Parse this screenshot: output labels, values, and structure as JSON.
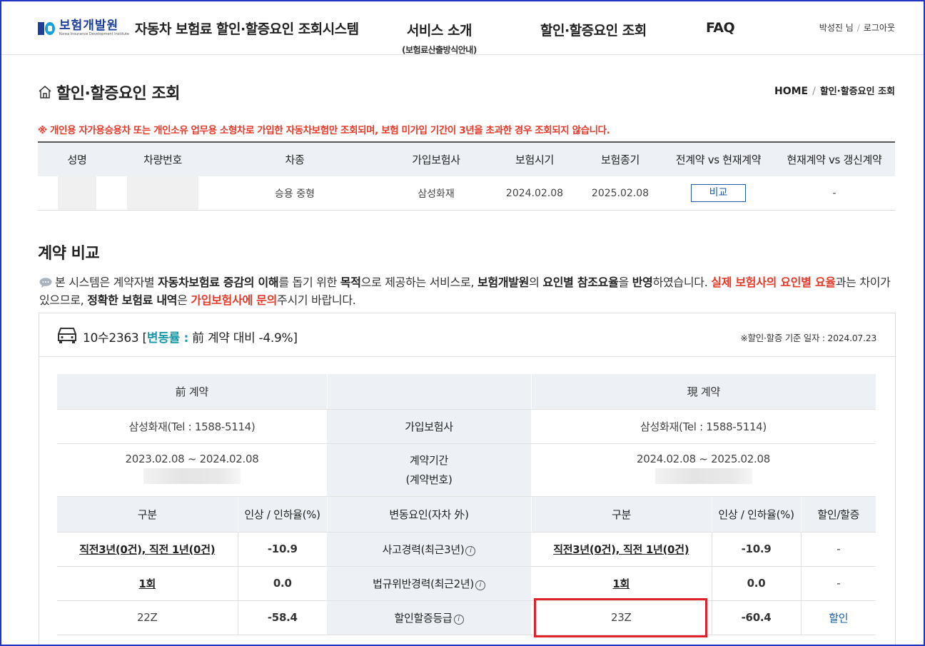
{
  "header": {
    "logo_kor": "보험개발원",
    "logo_eng": "Korea Insurance Development Institute",
    "system_title": "자동차 보험료 할인·할증요인 조회시스템",
    "nav": [
      {
        "label": "서비스 소개",
        "sub": "(보험료산출방식안내)"
      },
      {
        "label": "할인·할증요인 조회"
      },
      {
        "label": "FAQ"
      }
    ],
    "user_name": "박성진 님",
    "logout": "로그아웃"
  },
  "page": {
    "title": "할인·할증요인 조회",
    "breadcrumb": [
      "HOME",
      "할인·할증요인 조회"
    ],
    "notice": "※ 개인용 자가용승용차 또는 개인소유 업무용 소형차로 가입한 자동차보험만 조회되며, 보험 미가입 기간이 3년을 초과한 경우 조회되지 않습니다."
  },
  "vehicle_table": {
    "headers": [
      "성명",
      "차량번호",
      "차종",
      "가입보험사",
      "보험시기",
      "보험종기",
      "전계약 vs 현재계약",
      "현재계약 vs 갱신계약"
    ],
    "row": {
      "car_type": "승용 중형",
      "insurer": "삼성화재",
      "start": "2024.02.08",
      "end": "2025.02.08",
      "compare_btn": "비교",
      "renewal": "-"
    }
  },
  "section": {
    "title": "계약 비교",
    "desc": {
      "p1": "본 시스템은 계약자별 ",
      "b1": "자동차보험료 증감의 이해",
      "p2": "를 돕기 위한 ",
      "b2": "목적",
      "p3": "으로 제공하는 서비스로, ",
      "b3": "보험개발원",
      "p4": "의 ",
      "b4": "요인별 참조요율",
      "p5": "을 ",
      "b5": "반영",
      "p6": "하였습니다. ",
      "r1": "실제 보험사의 요인별 요율",
      "p7": "과는 차이가 있으므로, ",
      "b6": "정확한 보험료 내역",
      "p8": "은 ",
      "r2": "가입보험사에 문의",
      "p9": "주시기 바랍니다."
    }
  },
  "contract": {
    "plate": "10수2363",
    "change_open": "[",
    "change_label": "변동률 :",
    "change_text": "前 계약 대비 -4.9%",
    "change_close": "]",
    "ref_date": "※할인·할증 기준 일자 : 2024.07.23",
    "prev_header": "前 계약",
    "curr_header": "現 계약",
    "prev_insurer": "삼성화재(Tel : 1588-5114)",
    "curr_insurer": "삼성화재(Tel : 1588-5114)",
    "insurer_label": "가입보험사",
    "prev_period": "2023.02.08 ~ 2024.02.08",
    "curr_period": "2024.02.08 ~ 2025.02.08",
    "period_label": "계약기간",
    "period_label2": "(계약번호)",
    "factor_headers": [
      "구분",
      "인상 / 인하율(%)",
      "변동요인(자차 外)",
      "구분",
      "인상 / 인하율(%)",
      "할인/할증"
    ],
    "rows": [
      {
        "prev": "직전3년(0건), 직전 1년(0건)",
        "prev_rate": "-10.9",
        "factor": "사고경력(최근3년)",
        "curr": "직전3년(0건), 직전 1년(0건)",
        "curr_rate": "-10.9",
        "effect": "-"
      },
      {
        "prev": "1회",
        "prev_rate": "0.0",
        "factor": "법규위반경력(최근2년)",
        "curr": "1회",
        "curr_rate": "0.0",
        "effect": "-"
      },
      {
        "prev": "22Z",
        "prev_rate": "-58.4",
        "factor": "할인할증등급",
        "curr": "23Z",
        "curr_rate": "-60.4",
        "effect": "할인"
      }
    ]
  }
}
